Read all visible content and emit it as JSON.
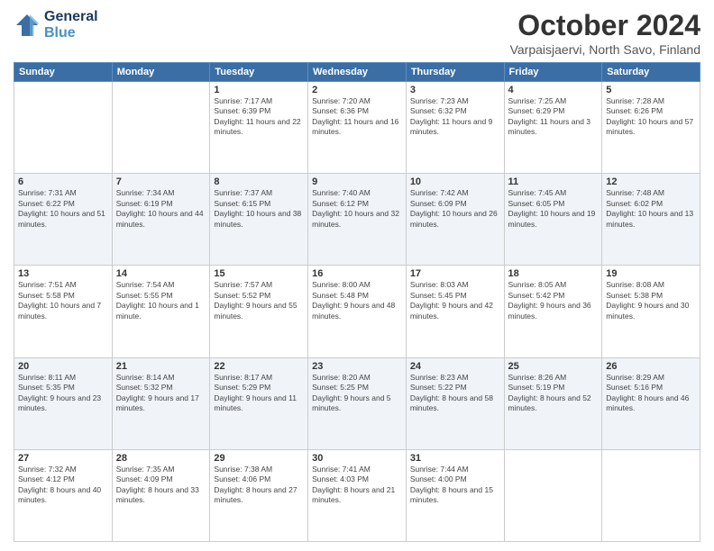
{
  "header": {
    "logo_line1": "General",
    "logo_line2": "Blue",
    "month": "October 2024",
    "location": "Varpaisjaervi, North Savo, Finland"
  },
  "days_of_week": [
    "Sunday",
    "Monday",
    "Tuesday",
    "Wednesday",
    "Thursday",
    "Friday",
    "Saturday"
  ],
  "weeks": [
    [
      {
        "num": "",
        "sunrise": "",
        "sunset": "",
        "daylight": ""
      },
      {
        "num": "",
        "sunrise": "",
        "sunset": "",
        "daylight": ""
      },
      {
        "num": "1",
        "sunrise": "Sunrise: 7:17 AM",
        "sunset": "Sunset: 6:39 PM",
        "daylight": "Daylight: 11 hours and 22 minutes."
      },
      {
        "num": "2",
        "sunrise": "Sunrise: 7:20 AM",
        "sunset": "Sunset: 6:36 PM",
        "daylight": "Daylight: 11 hours and 16 minutes."
      },
      {
        "num": "3",
        "sunrise": "Sunrise: 7:23 AM",
        "sunset": "Sunset: 6:32 PM",
        "daylight": "Daylight: 11 hours and 9 minutes."
      },
      {
        "num": "4",
        "sunrise": "Sunrise: 7:25 AM",
        "sunset": "Sunset: 6:29 PM",
        "daylight": "Daylight: 11 hours and 3 minutes."
      },
      {
        "num": "5",
        "sunrise": "Sunrise: 7:28 AM",
        "sunset": "Sunset: 6:26 PM",
        "daylight": "Daylight: 10 hours and 57 minutes."
      }
    ],
    [
      {
        "num": "6",
        "sunrise": "Sunrise: 7:31 AM",
        "sunset": "Sunset: 6:22 PM",
        "daylight": "Daylight: 10 hours and 51 minutes."
      },
      {
        "num": "7",
        "sunrise": "Sunrise: 7:34 AM",
        "sunset": "Sunset: 6:19 PM",
        "daylight": "Daylight: 10 hours and 44 minutes."
      },
      {
        "num": "8",
        "sunrise": "Sunrise: 7:37 AM",
        "sunset": "Sunset: 6:15 PM",
        "daylight": "Daylight: 10 hours and 38 minutes."
      },
      {
        "num": "9",
        "sunrise": "Sunrise: 7:40 AM",
        "sunset": "Sunset: 6:12 PM",
        "daylight": "Daylight: 10 hours and 32 minutes."
      },
      {
        "num": "10",
        "sunrise": "Sunrise: 7:42 AM",
        "sunset": "Sunset: 6:09 PM",
        "daylight": "Daylight: 10 hours and 26 minutes."
      },
      {
        "num": "11",
        "sunrise": "Sunrise: 7:45 AM",
        "sunset": "Sunset: 6:05 PM",
        "daylight": "Daylight: 10 hours and 19 minutes."
      },
      {
        "num": "12",
        "sunrise": "Sunrise: 7:48 AM",
        "sunset": "Sunset: 6:02 PM",
        "daylight": "Daylight: 10 hours and 13 minutes."
      }
    ],
    [
      {
        "num": "13",
        "sunrise": "Sunrise: 7:51 AM",
        "sunset": "Sunset: 5:58 PM",
        "daylight": "Daylight: 10 hours and 7 minutes."
      },
      {
        "num": "14",
        "sunrise": "Sunrise: 7:54 AM",
        "sunset": "Sunset: 5:55 PM",
        "daylight": "Daylight: 10 hours and 1 minute."
      },
      {
        "num": "15",
        "sunrise": "Sunrise: 7:57 AM",
        "sunset": "Sunset: 5:52 PM",
        "daylight": "Daylight: 9 hours and 55 minutes."
      },
      {
        "num": "16",
        "sunrise": "Sunrise: 8:00 AM",
        "sunset": "Sunset: 5:48 PM",
        "daylight": "Daylight: 9 hours and 48 minutes."
      },
      {
        "num": "17",
        "sunrise": "Sunrise: 8:03 AM",
        "sunset": "Sunset: 5:45 PM",
        "daylight": "Daylight: 9 hours and 42 minutes."
      },
      {
        "num": "18",
        "sunrise": "Sunrise: 8:05 AM",
        "sunset": "Sunset: 5:42 PM",
        "daylight": "Daylight: 9 hours and 36 minutes."
      },
      {
        "num": "19",
        "sunrise": "Sunrise: 8:08 AM",
        "sunset": "Sunset: 5:38 PM",
        "daylight": "Daylight: 9 hours and 30 minutes."
      }
    ],
    [
      {
        "num": "20",
        "sunrise": "Sunrise: 8:11 AM",
        "sunset": "Sunset: 5:35 PM",
        "daylight": "Daylight: 9 hours and 23 minutes."
      },
      {
        "num": "21",
        "sunrise": "Sunrise: 8:14 AM",
        "sunset": "Sunset: 5:32 PM",
        "daylight": "Daylight: 9 hours and 17 minutes."
      },
      {
        "num": "22",
        "sunrise": "Sunrise: 8:17 AM",
        "sunset": "Sunset: 5:29 PM",
        "daylight": "Daylight: 9 hours and 11 minutes."
      },
      {
        "num": "23",
        "sunrise": "Sunrise: 8:20 AM",
        "sunset": "Sunset: 5:25 PM",
        "daylight": "Daylight: 9 hours and 5 minutes."
      },
      {
        "num": "24",
        "sunrise": "Sunrise: 8:23 AM",
        "sunset": "Sunset: 5:22 PM",
        "daylight": "Daylight: 8 hours and 58 minutes."
      },
      {
        "num": "25",
        "sunrise": "Sunrise: 8:26 AM",
        "sunset": "Sunset: 5:19 PM",
        "daylight": "Daylight: 8 hours and 52 minutes."
      },
      {
        "num": "26",
        "sunrise": "Sunrise: 8:29 AM",
        "sunset": "Sunset: 5:16 PM",
        "daylight": "Daylight: 8 hours and 46 minutes."
      }
    ],
    [
      {
        "num": "27",
        "sunrise": "Sunrise: 7:32 AM",
        "sunset": "Sunset: 4:12 PM",
        "daylight": "Daylight: 8 hours and 40 minutes."
      },
      {
        "num": "28",
        "sunrise": "Sunrise: 7:35 AM",
        "sunset": "Sunset: 4:09 PM",
        "daylight": "Daylight: 8 hours and 33 minutes."
      },
      {
        "num": "29",
        "sunrise": "Sunrise: 7:38 AM",
        "sunset": "Sunset: 4:06 PM",
        "daylight": "Daylight: 8 hours and 27 minutes."
      },
      {
        "num": "30",
        "sunrise": "Sunrise: 7:41 AM",
        "sunset": "Sunset: 4:03 PM",
        "daylight": "Daylight: 8 hours and 21 minutes."
      },
      {
        "num": "31",
        "sunrise": "Sunrise: 7:44 AM",
        "sunset": "Sunset: 4:00 PM",
        "daylight": "Daylight: 8 hours and 15 minutes."
      },
      {
        "num": "",
        "sunrise": "",
        "sunset": "",
        "daylight": ""
      },
      {
        "num": "",
        "sunrise": "",
        "sunset": "",
        "daylight": ""
      }
    ]
  ]
}
